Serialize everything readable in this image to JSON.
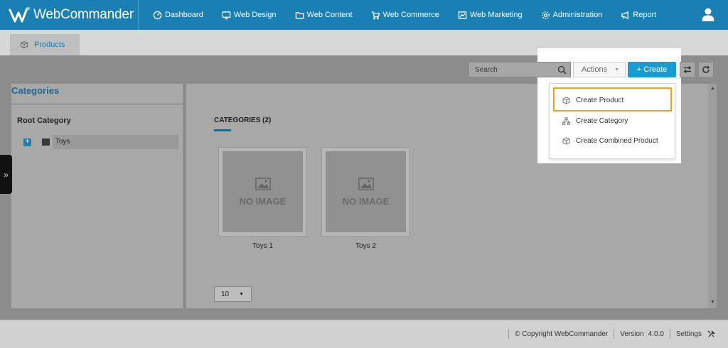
{
  "app": {
    "logo_text": "WebCommander"
  },
  "nav": {
    "items": [
      {
        "label": "Dashboard",
        "icon": "dashboard-icon"
      },
      {
        "label": "Web Design",
        "icon": "monitor-icon"
      },
      {
        "label": "Web Content",
        "icon": "folder-icon"
      },
      {
        "label": "Web Commerce",
        "icon": "cart-icon"
      },
      {
        "label": "Web Marketing",
        "icon": "chart-icon"
      },
      {
        "label": "Administration",
        "icon": "gear-icon"
      },
      {
        "label": "Report",
        "icon": "megaphone-icon"
      }
    ],
    "user_icon": "user-icon"
  },
  "tab": {
    "label": "Products",
    "icon": "box-icon"
  },
  "toolbar": {
    "search_placeholder": "Search",
    "actions_label": "Actions",
    "create_label": "+ Create"
  },
  "dropdown": {
    "items": [
      {
        "label": "Create Product",
        "icon": "box-icon",
        "highlighted": true
      },
      {
        "label": "Create Category",
        "icon": "hierarchy-icon"
      },
      {
        "label": "Create Combined Product",
        "icon": "box-icon"
      }
    ]
  },
  "sidebar": {
    "title": "Categories",
    "root_label": "Root Category",
    "tree": [
      {
        "label": "Toys",
        "expand_symbol": "+"
      }
    ],
    "handle_symbol": "»"
  },
  "main": {
    "heading": "CATEGORIES (2)",
    "cards": [
      {
        "placeholder": "NO IMAGE",
        "label": "Toys 1"
      },
      {
        "placeholder": "NO IMAGE",
        "label": "Toys 2"
      }
    ],
    "page_size": "10"
  },
  "footer": {
    "copyright": "© Copyright WebCommander",
    "version_label": "Version",
    "version_value": "4.0.0",
    "settings_label": "Settings"
  },
  "colors": {
    "brand_blue": "#1a7fb2",
    "create_button": "#1a9bd0",
    "highlight_border": "#e8a628"
  }
}
